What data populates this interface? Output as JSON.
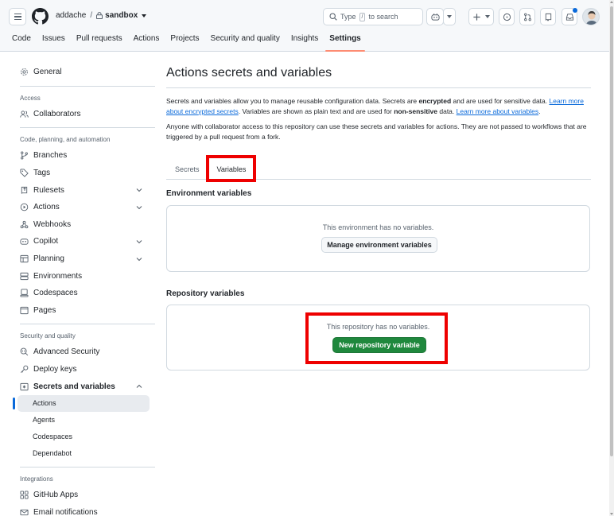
{
  "header": {
    "owner": "addache",
    "separator": "/",
    "repo": "sandbox",
    "search_prefix": "Type",
    "search_key": "/",
    "search_suffix": "to search"
  },
  "repo_tabs": [
    "Code",
    "Issues",
    "Pull requests",
    "Actions",
    "Projects",
    "Security and quality",
    "Insights",
    "Settings"
  ],
  "active_tab": "Settings",
  "sidebar": {
    "general": "General",
    "access_heading": "Access",
    "collaborators": "Collaborators",
    "code_heading": "Code, planning, and automation",
    "branches": "Branches",
    "tags": "Tags",
    "rulesets": "Rulesets",
    "actions": "Actions",
    "webhooks": "Webhooks",
    "copilot": "Copilot",
    "planning": "Planning",
    "environments": "Environments",
    "codespaces": "Codespaces",
    "pages": "Pages",
    "security_heading": "Security and quality",
    "advanced_security": "Advanced Security",
    "deploy_keys": "Deploy keys",
    "secrets_variables": "Secrets and variables",
    "sub_actions": "Actions",
    "sub_agents": "Agents",
    "sub_codespaces": "Codespaces",
    "sub_dependabot": "Dependabot",
    "integrations_heading": "Integrations",
    "github_apps": "GitHub Apps",
    "email_notifications": "Email notifications"
  },
  "main": {
    "title": "Actions secrets and variables",
    "desc1_a": "Secrets and variables allow you to manage reusable configuration data. Secrets are ",
    "desc1_b": "encrypted",
    "desc1_c": " and are used for sensitive data. ",
    "desc1_link1": "Learn more about encrypted secrets",
    "desc1_d": ". Variables are shown as plain text and are used for ",
    "desc1_e": "non-sensitive",
    "desc1_f": " data. ",
    "desc1_link2": "Learn more about variables",
    "desc1_g": ".",
    "desc2": "Anyone with collaborator access to this repository can use these secrets and variables for actions. They are not passed to workflows that are triggered by a pull request from a fork.",
    "tab_secrets": "Secrets",
    "tab_variables": "Variables",
    "env_title": "Environment variables",
    "env_empty": "This environment has no variables.",
    "env_button": "Manage environment variables",
    "repo_title": "Repository variables",
    "repo_empty": "This repository has no variables.",
    "repo_button": "New repository variable"
  },
  "colors": {
    "accent": "#0969da",
    "primary_button": "#1f883d",
    "highlight": "#ee0000",
    "tab_underline": "#fd8c73"
  }
}
